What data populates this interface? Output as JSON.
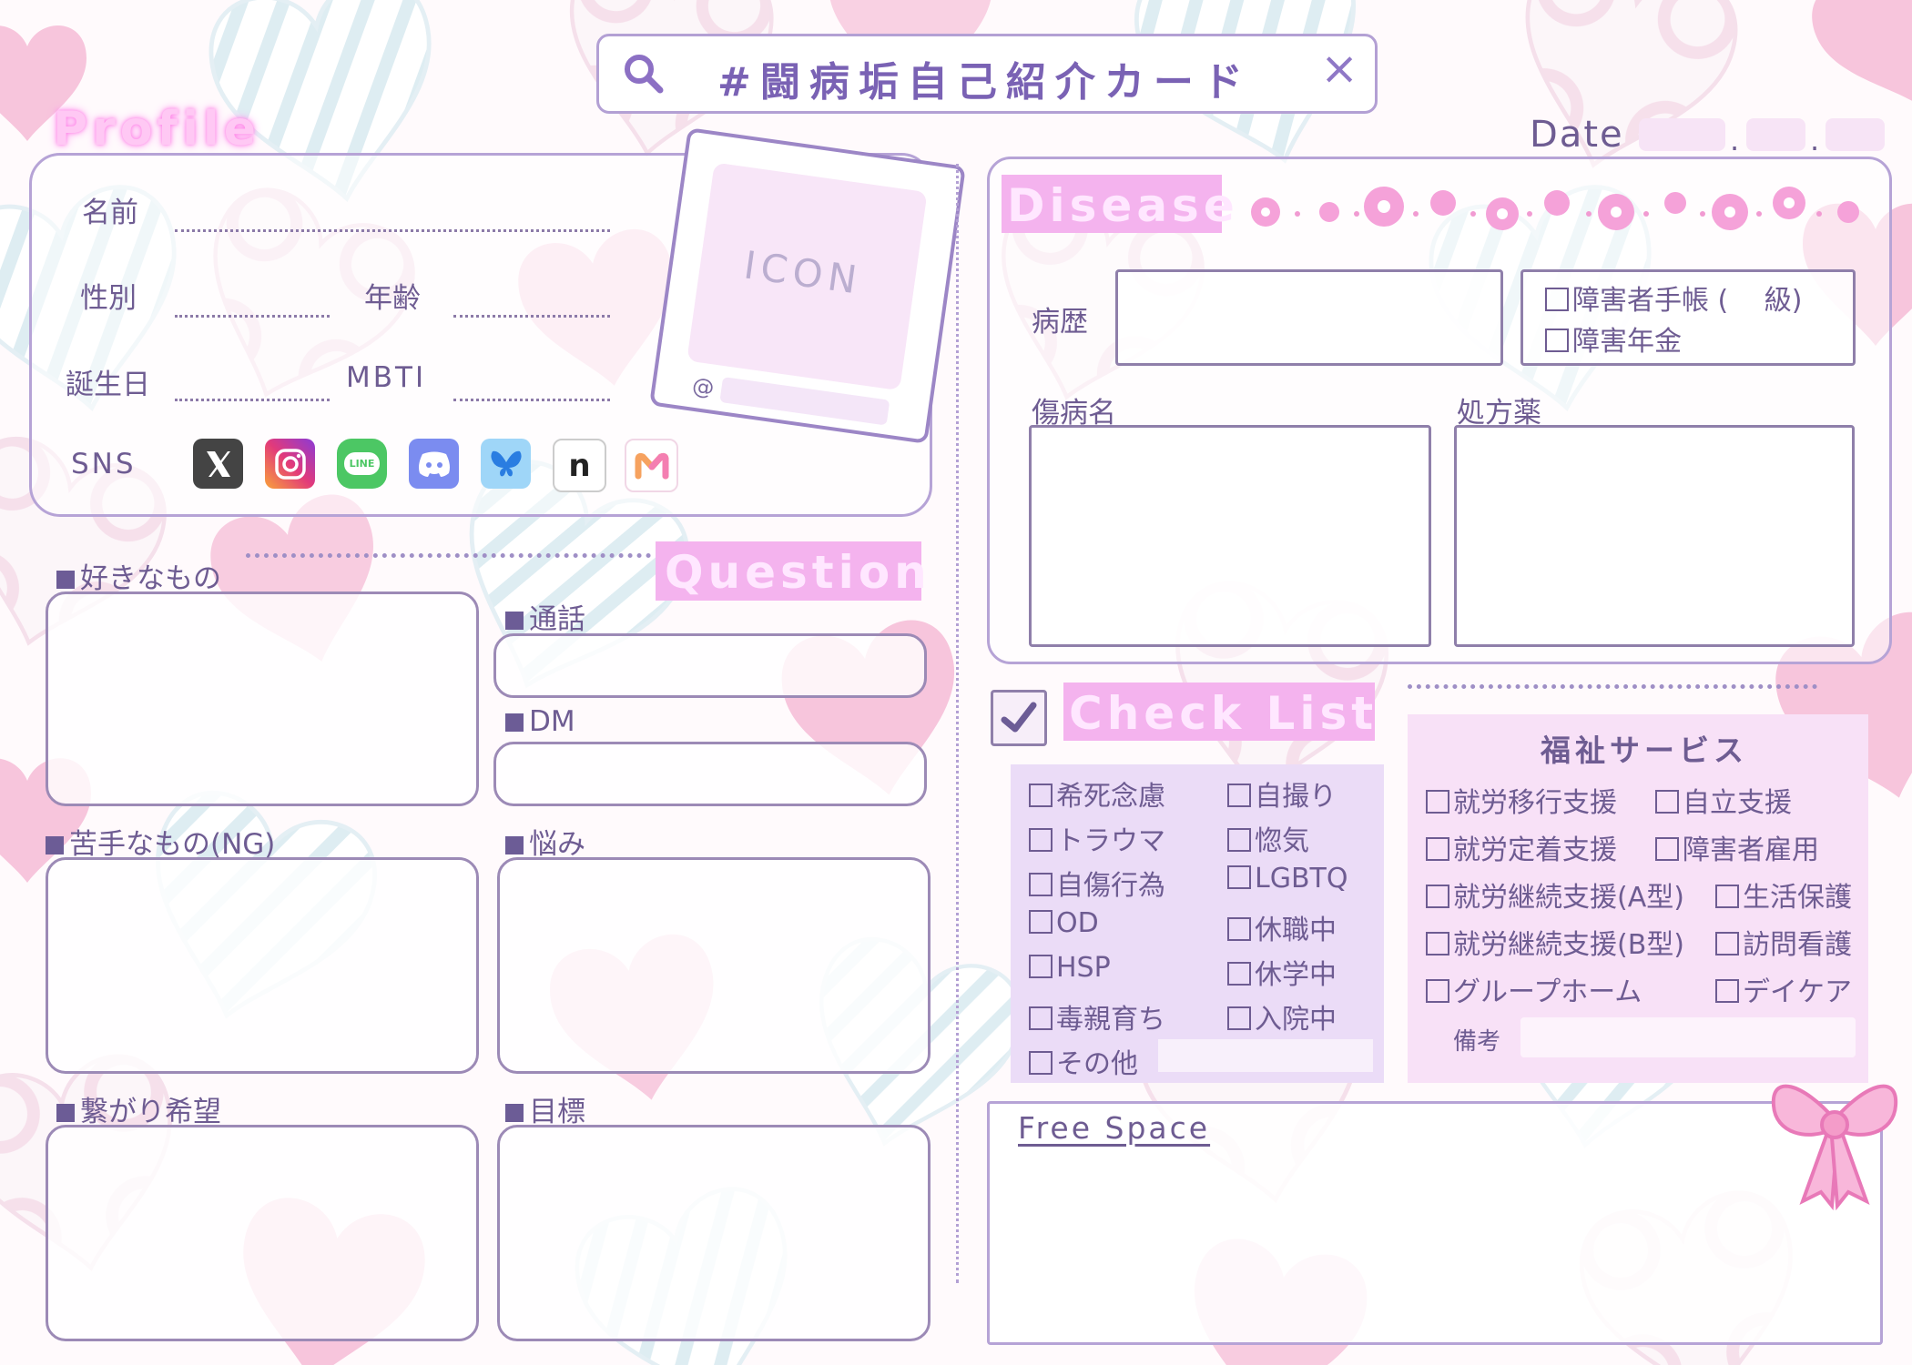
{
  "search": {
    "text": "#闘病垢自己紹介カード",
    "close": "×"
  },
  "date": {
    "label": "Date",
    "sep1": ".",
    "sep2": "."
  },
  "profile": {
    "title": "Profile",
    "name_label": "名前",
    "gender_label": "性別",
    "age_label": "年齢",
    "birthday_label": "誕生日",
    "mbti_label": "MBTI",
    "sns_label": "SNS",
    "icon_label": "ICON",
    "handle_prefix": "@",
    "sns_icons": [
      "x-icon",
      "instagram-icon",
      "line-icon",
      "discord-icon",
      "bluesky-icon",
      "note-icon",
      "misskey-icon"
    ],
    "line_text": "LINE",
    "note_text": "n"
  },
  "question": {
    "title": "Question",
    "likes": "好きなもの",
    "call": "通話",
    "dm": "DM",
    "dislikes": "苦手なもの(NG)",
    "worries": "悩み",
    "connections": "繋がり希望",
    "goals": "目標"
  },
  "disease": {
    "title": "Disease",
    "history_label": "病歴",
    "options": [
      "障害者手帳 (　 級)",
      "障害年金"
    ],
    "diagnosis_label": "傷病名",
    "prescription_label": "処方薬"
  },
  "checklist": {
    "title": "Check List",
    "col1": [
      "希死念慮",
      "トラウマ",
      "自傷行為",
      "OD",
      "HSP",
      "毒親育ち",
      "その他"
    ],
    "col2": [
      "自撮り",
      "惚気",
      "LGBTQ",
      "休職中",
      "休学中",
      "入院中"
    ]
  },
  "welfare": {
    "title": "福祉サービス",
    "rows": [
      [
        "就労移行支援",
        "自立支援"
      ],
      [
        "就労定着支援",
        "障害者雇用"
      ],
      [
        "就労継続支援(A型)",
        "生活保護"
      ],
      [
        "就労継続支援(B型)",
        "訪問看護"
      ],
      [
        "グループホーム",
        "デイケア"
      ]
    ],
    "notes_label": "備考"
  },
  "free_space": {
    "title": "Free Space"
  },
  "colors": {
    "accent": "#7b63b8",
    "pink": "#f4b3ee",
    "border": "#b6a3d6"
  }
}
